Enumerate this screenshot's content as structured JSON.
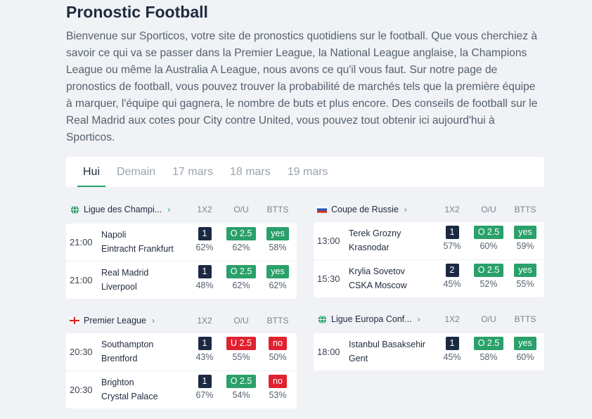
{
  "page": {
    "title": "Pronostic Football",
    "intro": "Bienvenue sur Sporticos, votre site de pronostics quotidiens sur le football. Que vous cherchiez à savoir ce qui va se passer dans la Premier League, la National League anglaise, la Champions League ou même la Australia A League, nous avons ce qu'il vous faut. Sur notre page de pronostics de football, vous pouvez trouver la probabilité de marchés tels que la première équipe à marquer, l'équipe qui gagnera, le nombre de buts et plus encore. Des conseils de football sur le Real Madrid aux cotes pour City contre United, vous pouvez tout obtenir ici aujourd'hui à Sporticos."
  },
  "tabs": [
    {
      "label": "Hui",
      "active": true
    },
    {
      "label": "Demain",
      "active": false
    },
    {
      "label": "17 mars",
      "active": false
    },
    {
      "label": "18 mars",
      "active": false
    },
    {
      "label": "19 mars",
      "active": false
    }
  ],
  "columns": {
    "c1": "1X2",
    "c2": "O/U",
    "c3": "BTTS"
  },
  "colors": {
    "accent": "#2aa06a",
    "dark_badge": "#1c2943",
    "red_badge": "#e02230"
  },
  "competitions": [
    {
      "name": "Ligue des Champi...",
      "icon": "globe-icon",
      "matches": [
        {
          "time": "21:00",
          "home": "Napoli",
          "away": "Eintracht Frankfurt",
          "x12": "1",
          "x12_pct": "62%",
          "ou": "O 2.5",
          "ou_type": "green",
          "ou_pct": "62%",
          "btts": "yes",
          "btts_type": "green",
          "btts_pct": "58%"
        },
        {
          "time": "21:00",
          "home": "Real Madrid",
          "away": "Liverpool",
          "x12": "1",
          "x12_pct": "48%",
          "ou": "O 2.5",
          "ou_type": "green",
          "ou_pct": "62%",
          "btts": "yes",
          "btts_type": "green",
          "btts_pct": "62%"
        }
      ]
    },
    {
      "name": "Coupe de Russie",
      "icon": "russia-flag-icon",
      "matches": [
        {
          "time": "13:00",
          "home": "Terek Grozny",
          "away": "Krasnodar",
          "x12": "1",
          "x12_pct": "57%",
          "ou": "O 2.5",
          "ou_type": "green",
          "ou_pct": "60%",
          "btts": "yes",
          "btts_type": "green",
          "btts_pct": "59%"
        },
        {
          "time": "15:30",
          "home": "Krylia Sovetov",
          "away": "CSKA Moscow",
          "x12": "2",
          "x12_pct": "45%",
          "ou": "O 2.5",
          "ou_type": "green",
          "ou_pct": "52%",
          "btts": "yes",
          "btts_type": "green",
          "btts_pct": "55%"
        }
      ]
    },
    {
      "name": "Premier League",
      "icon": "england-flag-icon",
      "matches": [
        {
          "time": "20:30",
          "home": "Southampton",
          "away": "Brentford",
          "x12": "1",
          "x12_pct": "43%",
          "ou": "U 2.5",
          "ou_type": "red",
          "ou_pct": "55%",
          "btts": "no",
          "btts_type": "red",
          "btts_pct": "50%"
        },
        {
          "time": "20:30",
          "home": "Brighton",
          "away": "Crystal Palace",
          "x12": "1",
          "x12_pct": "67%",
          "ou": "O 2.5",
          "ou_type": "green",
          "ou_pct": "54%",
          "btts": "no",
          "btts_type": "red",
          "btts_pct": "53%"
        }
      ]
    },
    {
      "name": "Ligue Europa Conf...",
      "icon": "globe-icon",
      "matches": [
        {
          "time": "18:00",
          "home": "Istanbul Basaksehir",
          "away": "Gent",
          "x12": "1",
          "x12_pct": "45%",
          "ou": "O 2.5",
          "ou_type": "green",
          "ou_pct": "58%",
          "btts": "yes",
          "btts_type": "green",
          "btts_pct": "60%"
        }
      ]
    }
  ]
}
